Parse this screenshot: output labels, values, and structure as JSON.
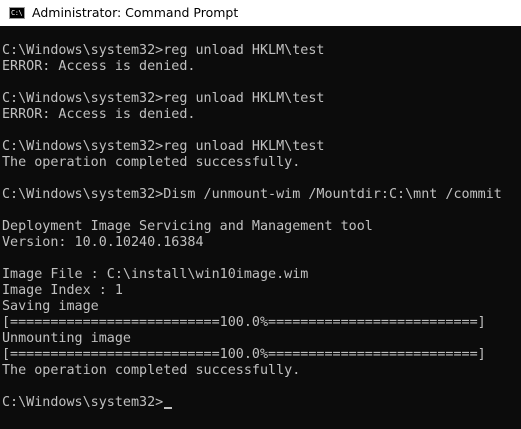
{
  "window": {
    "title": "Administrator: Command Prompt",
    "icon_glyph": "C:\\",
    "icon": "cmd-icon"
  },
  "console": {
    "lines": [
      "C:\\Windows\\system32>reg unload HKLM\\test",
      "ERROR: Access is denied.",
      "",
      "C:\\Windows\\system32>reg unload HKLM\\test",
      "ERROR: Access is denied.",
      "",
      "C:\\Windows\\system32>reg unload HKLM\\test",
      "The operation completed successfully.",
      "",
      "C:\\Windows\\system32>Dism /unmount-wim /Mountdir:C:\\mnt /commit",
      "",
      "Deployment Image Servicing and Management tool",
      "Version: 10.0.10240.16384",
      "",
      "Image File : C:\\install\\win10image.wim",
      "Image Index : 1",
      "Saving image",
      "[==========================100.0%==========================]",
      "Unmounting image",
      "[==========================100.0%==========================]",
      "The operation completed successfully.",
      "",
      "C:\\Windows\\system32>"
    ]
  },
  "colors": {
    "background": "#0c0c0c",
    "text": "#c0c0c0",
    "titlebar": "#ffffff"
  }
}
